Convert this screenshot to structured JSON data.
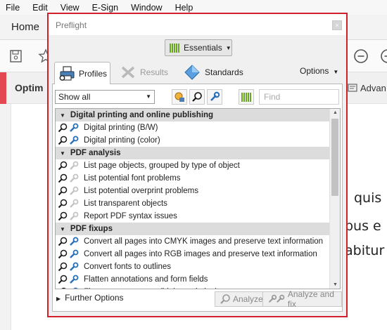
{
  "menubar": {
    "items": [
      "File",
      "Edit",
      "View",
      "E-Sign",
      "Window",
      "Help"
    ]
  },
  "app": {
    "home_tab": "Home",
    "section_label": "Optim",
    "advanced_label": "Advan"
  },
  "document": {
    "lines": [
      "quis",
      "bus e",
      "abitur",
      "."
    ]
  },
  "dialog": {
    "title": "Preflight",
    "close_glyph": "×",
    "essentials_label": "Essentials",
    "tabs": [
      {
        "label": "Profiles",
        "active": true
      },
      {
        "label": "Results",
        "active": false
      },
      {
        "label": "Standards",
        "active": false
      }
    ],
    "options_label": "Options",
    "filter_value": "Show all",
    "find_placeholder": "Find",
    "groups": [
      {
        "name": "Digital printing and online publishing",
        "items": [
          "Digital printing (B/W)",
          "Digital printing (color)"
        ]
      },
      {
        "name": "PDF analysis",
        "items": [
          "List page objects, grouped by type of object",
          "List potential font problems",
          "List potential overprint problems",
          "List transparent objects",
          "Report PDF syntax issues"
        ]
      },
      {
        "name": "PDF fixups",
        "items": [
          "Convert all pages into CMYK images and preserve text information",
          "Convert all pages into RGB images and preserve text information",
          "Convert fonts to outlines",
          "Flatten annotations and form fields",
          "Flatten transparency (high resolution)"
        ]
      }
    ],
    "further_options_label": "Further Options",
    "analyze_label": "Analyze",
    "analyze_fix_label": "Analyze and fix"
  },
  "colors": {
    "highlight": "#d0202a",
    "accent_green": "#6aa523",
    "wrench_blue": "#2a70b8"
  }
}
